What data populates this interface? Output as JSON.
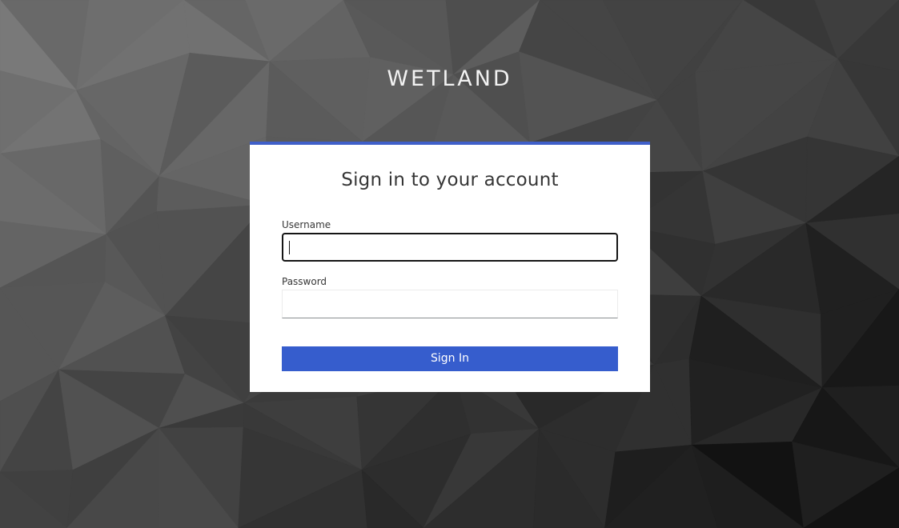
{
  "brand": {
    "name": "WETLAND"
  },
  "login": {
    "title": "Sign in to your account",
    "username_label": "Username",
    "username_value": "",
    "password_label": "Password",
    "password_value": "",
    "submit_label": "Sign In"
  },
  "colors": {
    "accent": "#365dcd",
    "card_top_border": "#3f5fc9",
    "background_light": "#7a7a7a",
    "background_dark": "#0d0d0d"
  }
}
